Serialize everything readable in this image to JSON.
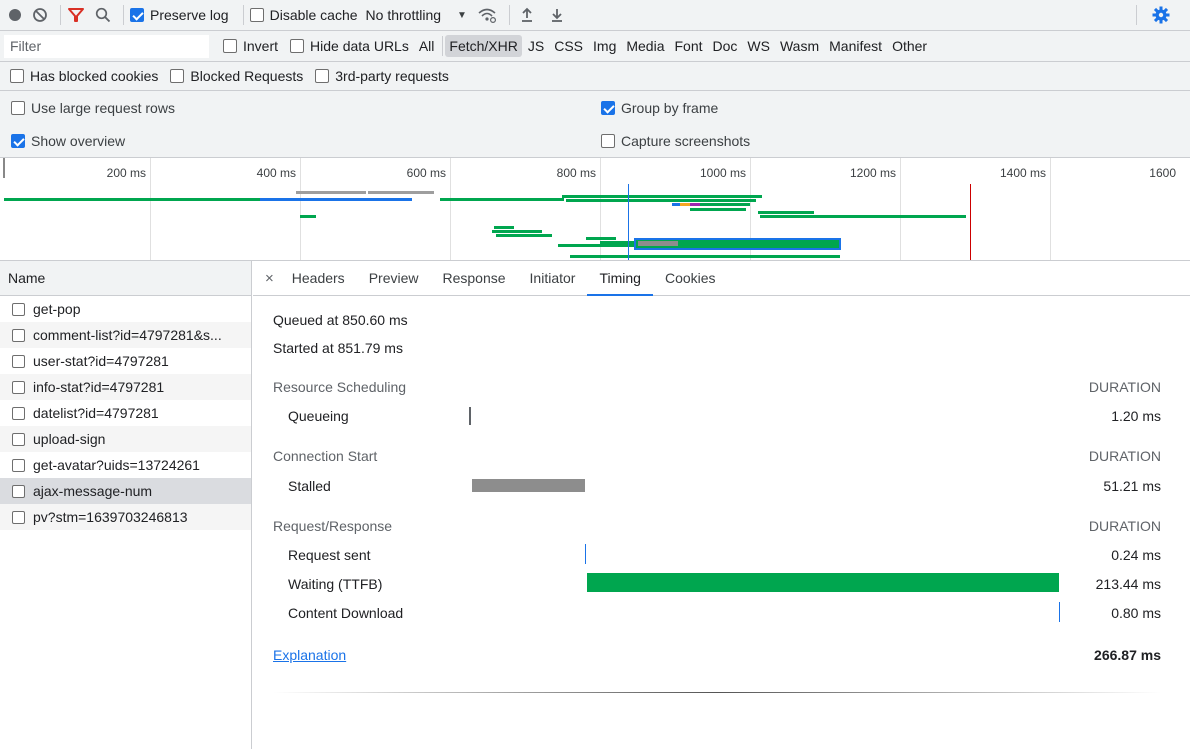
{
  "toolbar": {
    "preserve_log": "Preserve log",
    "disable_cache": "Disable cache",
    "throttling": "No throttling",
    "throttle_arrow": "▼"
  },
  "filter": {
    "placeholder": "Filter",
    "invert": "Invert",
    "hide_data_urls": "Hide data URLs",
    "types": [
      "All",
      "Fetch/XHR",
      "JS",
      "CSS",
      "Img",
      "Media",
      "Font",
      "Doc",
      "WS",
      "Wasm",
      "Manifest",
      "Other"
    ],
    "active_type": "Fetch/XHR",
    "has_blocked_cookies": "Has blocked cookies",
    "blocked_requests": "Blocked Requests",
    "third_party": "3rd-party requests"
  },
  "settings": {
    "large_rows": "Use large request rows",
    "group_by_frame": "Group by frame",
    "show_overview": "Show overview",
    "capture_screenshots": "Capture screenshots"
  },
  "overview": {
    "ticks": [
      "200 ms",
      "400 ms",
      "600 ms",
      "800 ms",
      "1000 ms",
      "1200 ms",
      "1400 ms",
      "1600"
    ]
  },
  "requests": {
    "header": "Name",
    "items": [
      "get-pop",
      "comment-list?id=4797281&s...",
      "user-stat?id=4797281",
      "info-stat?id=4797281",
      "datelist?id=4797281",
      "upload-sign",
      "get-avatar?uids=13724261",
      "ajax-message-num",
      "pv?stm=1639703246813"
    ],
    "selected_index": 7
  },
  "tabs": {
    "close": "×",
    "items": [
      "Headers",
      "Preview",
      "Response",
      "Initiator",
      "Timing",
      "Cookies"
    ],
    "active": "Timing"
  },
  "timing": {
    "queued_at": "Queued at 850.60 ms",
    "started_at": "Started at 851.79 ms",
    "duration_header": "DURATION",
    "sections": [
      {
        "title": "Resource Scheduling",
        "rows": [
          {
            "label": "Queueing",
            "value": "1.20 ms"
          }
        ]
      },
      {
        "title": "Connection Start",
        "rows": [
          {
            "label": "Stalled",
            "value": "51.21 ms"
          }
        ]
      },
      {
        "title": "Request/Response",
        "rows": [
          {
            "label": "Request sent",
            "value": "0.24 ms"
          },
          {
            "label": "Waiting (TTFB)",
            "value": "213.44 ms"
          },
          {
            "label": "Content Download",
            "value": "0.80 ms"
          }
        ]
      }
    ],
    "explanation": "Explanation",
    "total": "266.87 ms"
  },
  "colors": {
    "accent": "#1a73e8",
    "waiting": "#00a64f",
    "stalled": "#8d8d8d",
    "filter_red": "#d93025",
    "load_line": "#cc0000"
  },
  "icons": {
    "record": "record-icon",
    "clear": "clear-icon",
    "filter": "filter-icon",
    "search": "search-icon",
    "wifi": "network-conditions-icon",
    "import": "import-har-icon",
    "export": "export-har-icon",
    "settings": "gear-icon"
  }
}
